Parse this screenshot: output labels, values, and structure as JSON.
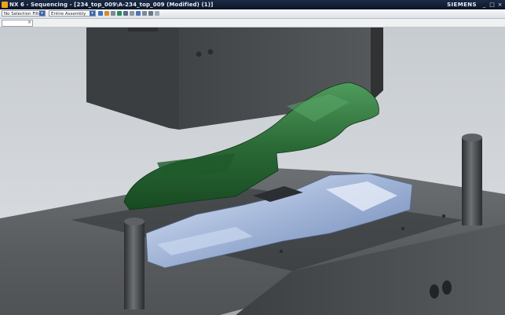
{
  "window": {
    "title": "NX 6 - Sequencing - [234_top_009\\A-234_top_009 (Modified)   (1)]",
    "brand": "SIEMENS",
    "buttons": {
      "minimize": "_",
      "maximize": "□",
      "close": "×"
    }
  },
  "toolbar": {
    "selection_filter": "No Selection Filter",
    "assembly_scope": "Entire Assembly",
    "icons": [
      "snap-icon",
      "filter-icon",
      "select-icon",
      "sketch-icon",
      "view-icon",
      "zoom-icon",
      "rotate-icon",
      "fit-icon",
      "render-icon",
      "layer-icon"
    ]
  },
  "strip": {
    "clear_label": "×"
  },
  "colors": {
    "titlebar": "#0f1d36",
    "part_green": "#2f6e3a",
    "core_blue": "#9fb3d6",
    "mold_gray": "#4f5254"
  },
  "viewport": {
    "content": [
      "upper-mold-plate",
      "molded-part-green",
      "lower-mold-base",
      "core-insert-blue",
      "guide-pin-left",
      "guide-pin-right",
      "guide-pin-front"
    ]
  }
}
